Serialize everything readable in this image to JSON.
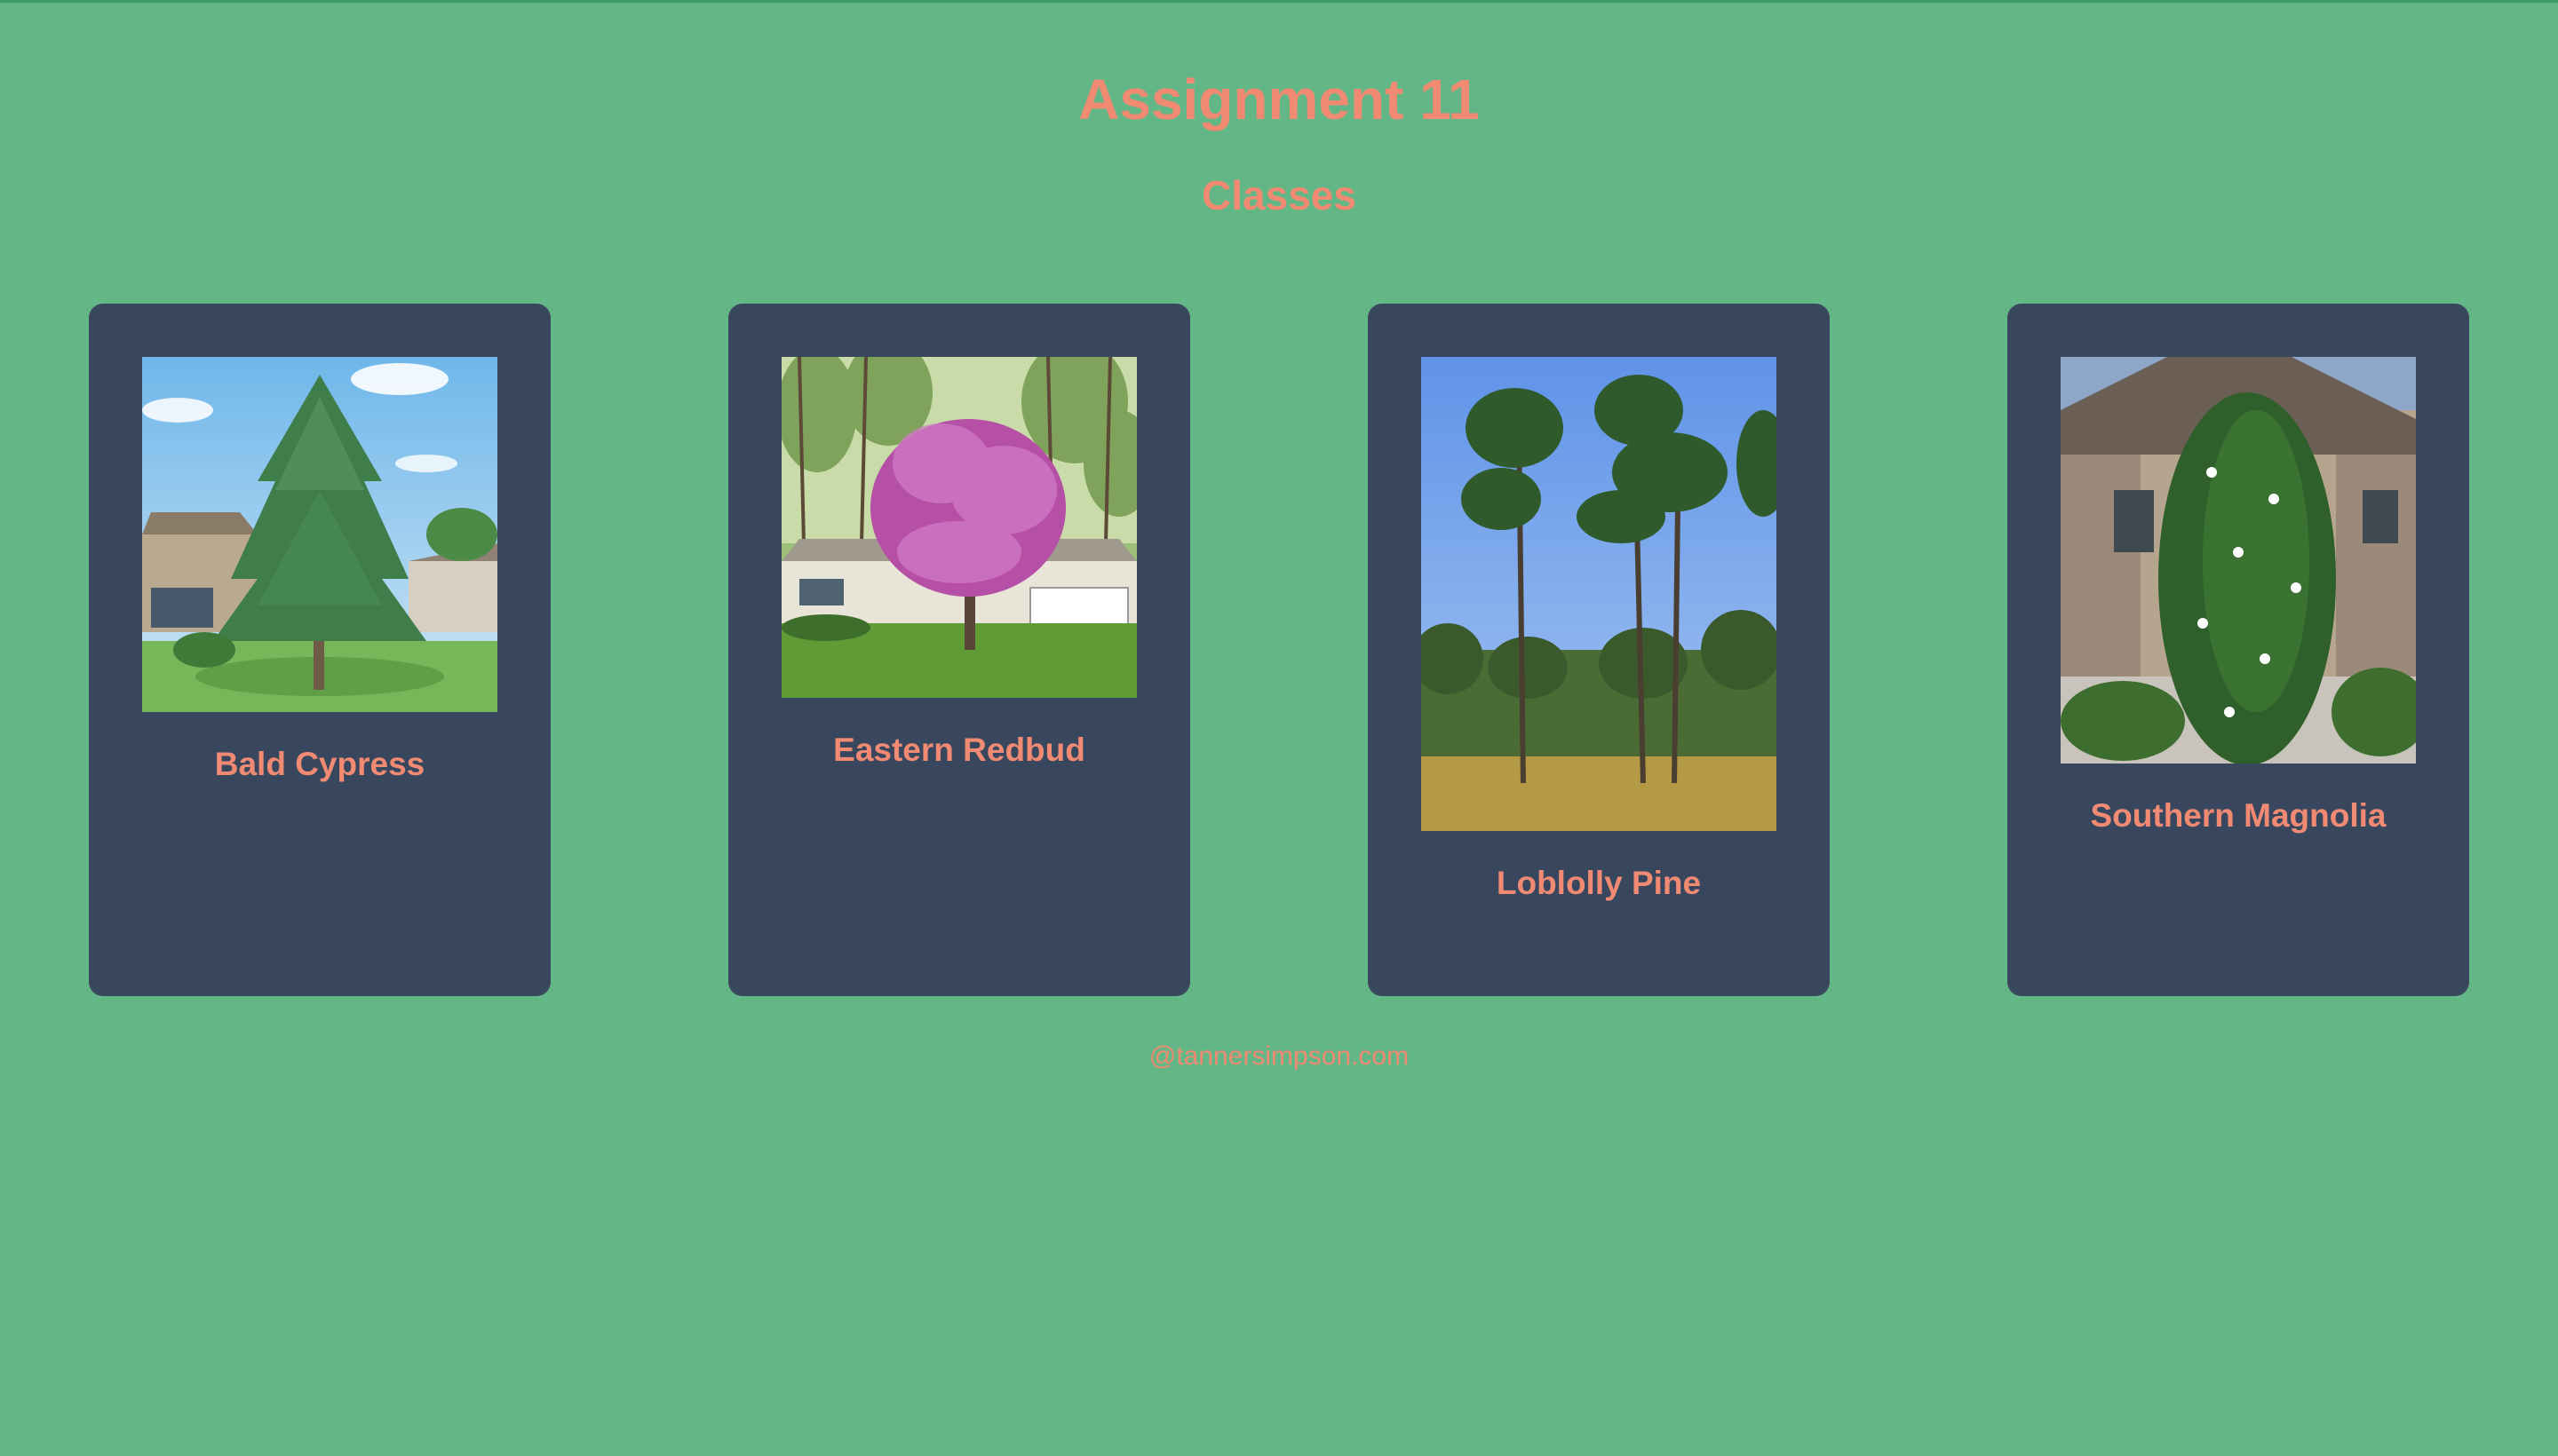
{
  "header": {
    "title": "Assignment 11",
    "subtitle": "Classes"
  },
  "cards": [
    {
      "name": "Bald Cypress",
      "image_icon": "bald-cypress-photo"
    },
    {
      "name": "Eastern Redbud",
      "image_icon": "eastern-redbud-photo"
    },
    {
      "name": "Loblolly Pine",
      "image_icon": "loblolly-pine-photo"
    },
    {
      "name": "Southern Magnolia",
      "image_icon": "southern-magnolia-photo"
    }
  ],
  "footer": {
    "text": "@tannersimpson.com"
  },
  "colors": {
    "background": "#63b685",
    "card": "#39475e",
    "accent": "#f08a73"
  }
}
